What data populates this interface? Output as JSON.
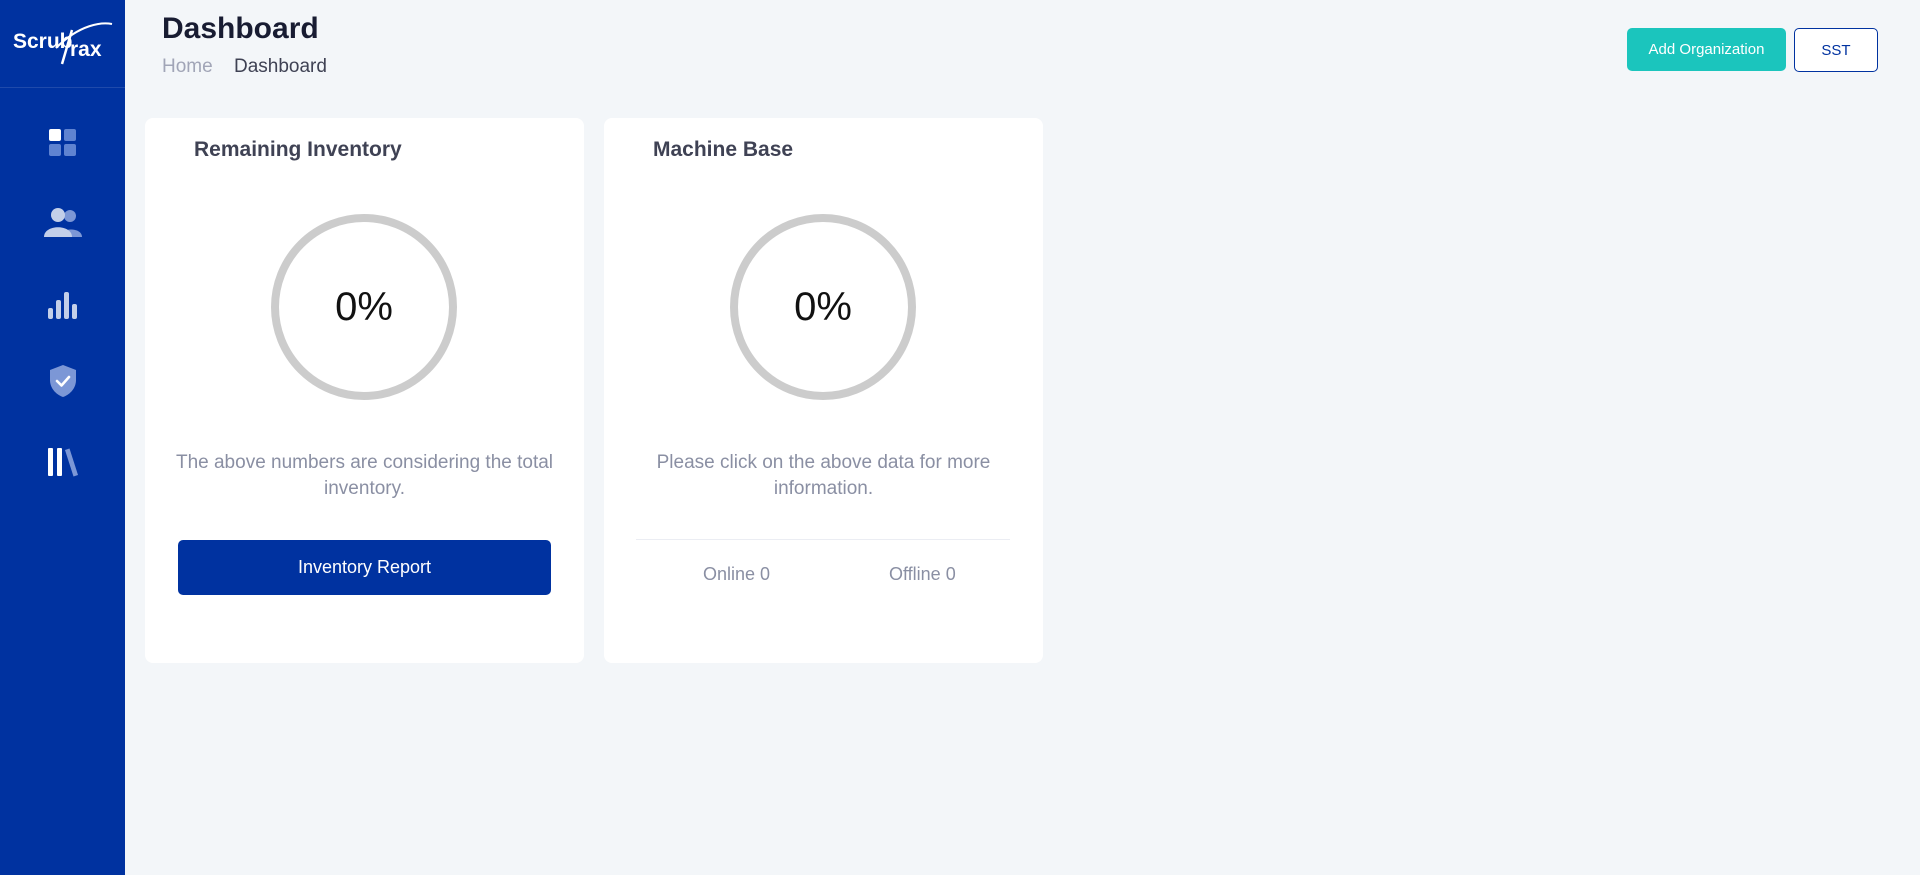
{
  "app": {
    "logo_text": "ScrubTrax"
  },
  "sidebar": {
    "items": [
      {
        "icon": "dashboard-icon"
      },
      {
        "icon": "users-icon"
      },
      {
        "icon": "bar-chart-icon"
      },
      {
        "icon": "shield-check-icon"
      },
      {
        "icon": "library-icon"
      }
    ]
  },
  "header": {
    "title": "Dashboard",
    "breadcrumb": {
      "home": "Home",
      "current": "Dashboard"
    },
    "add_org_label": "Add Organization",
    "sst_label": "SST"
  },
  "cards": {
    "inventory": {
      "title": "Remaining Inventory",
      "percent": "0%",
      "note": "The above numbers are considering the total inventory.",
      "button_label": "Inventory Report"
    },
    "machine": {
      "title": "Machine Base",
      "percent": "0%",
      "note": "Please click on the above data for more information.",
      "online": "Online 0",
      "offline": "Offline 0"
    }
  },
  "colors": {
    "sidebar": "#0032a0",
    "accent_teal": "#1bc5bd",
    "primary_button": "#0032a0",
    "ring": "#cccccc",
    "page_bg": "#f3f6f9"
  }
}
